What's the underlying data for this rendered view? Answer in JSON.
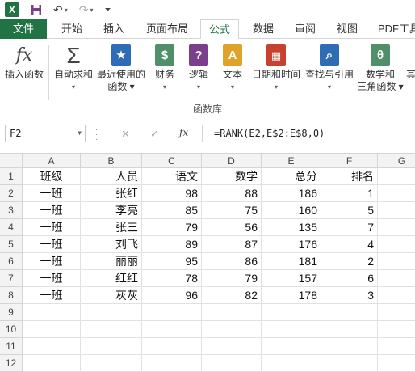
{
  "qat": {
    "app_icon": "X",
    "icons": [
      "save-icon",
      "undo-icon",
      "redo-icon",
      "customize-icon"
    ]
  },
  "tabs": [
    {
      "label": "文件"
    },
    {
      "label": "开始"
    },
    {
      "label": "插入"
    },
    {
      "label": "页面布局"
    },
    {
      "label": "公式"
    },
    {
      "label": "数据"
    },
    {
      "label": "审阅"
    },
    {
      "label": "视图"
    },
    {
      "label": "PDF工具"
    }
  ],
  "ribbon": {
    "buttons": [
      {
        "line1": "插入函数",
        "line2": "",
        "icon": "fx"
      },
      {
        "line1": "自动求和",
        "line2": "▾",
        "icon": "Σ"
      },
      {
        "line1": "最近使用的",
        "line2": "函数 ▾",
        "icon": "★"
      },
      {
        "line1": "财务",
        "line2": "▾",
        "icon": "$"
      },
      {
        "line1": "逻辑",
        "line2": "▾",
        "icon": "?"
      },
      {
        "line1": "文本",
        "line2": "▾",
        "icon": "A"
      },
      {
        "line1": "日期和时间",
        "line2": "▾",
        "icon": "▦"
      },
      {
        "line1": "查找与引用",
        "line2": "▾",
        "icon": "⌕"
      },
      {
        "line1": "数学和",
        "line2": "三角函数 ▾",
        "icon": "θ"
      },
      {
        "line1": "其",
        "line2": "",
        "icon": ""
      }
    ],
    "group_label": "函数库"
  },
  "formula_bar": {
    "name_box": "F2",
    "fx": "fx",
    "formula": "=RANK(E2,E$2:E$8,0)"
  },
  "sheet": {
    "columns": [
      "A",
      "B",
      "C",
      "D",
      "E",
      "F",
      "G"
    ],
    "row_numbers": [
      "1",
      "2",
      "3",
      "4",
      "5",
      "6",
      "7",
      "8",
      "9",
      "10",
      "11",
      "12"
    ],
    "rows": [
      [
        "班级",
        "人员",
        "语文",
        "数学",
        "总分",
        "排名",
        ""
      ],
      [
        "一班",
        "张红",
        "98",
        "88",
        "186",
        "1",
        ""
      ],
      [
        "一班",
        "李亮",
        "85",
        "75",
        "160",
        "5",
        ""
      ],
      [
        "一班",
        "张三",
        "79",
        "56",
        "135",
        "7",
        ""
      ],
      [
        "一班",
        "刘飞",
        "89",
        "87",
        "176",
        "4",
        ""
      ],
      [
        "一班",
        "丽丽",
        "95",
        "86",
        "181",
        "2",
        ""
      ],
      [
        "一班",
        "红红",
        "78",
        "79",
        "157",
        "6",
        ""
      ],
      [
        "一班",
        "灰灰",
        "96",
        "82",
        "178",
        "3",
        ""
      ],
      [
        "",
        "",
        "",
        "",
        "",
        "",
        ""
      ],
      [
        "",
        "",
        "",
        "",
        "",
        "",
        ""
      ],
      [
        "",
        "",
        "",
        "",
        "",
        "",
        ""
      ],
      [
        "",
        "",
        "",
        "",
        "",
        "",
        ""
      ]
    ]
  },
  "colors": {
    "accent": "#217346"
  }
}
